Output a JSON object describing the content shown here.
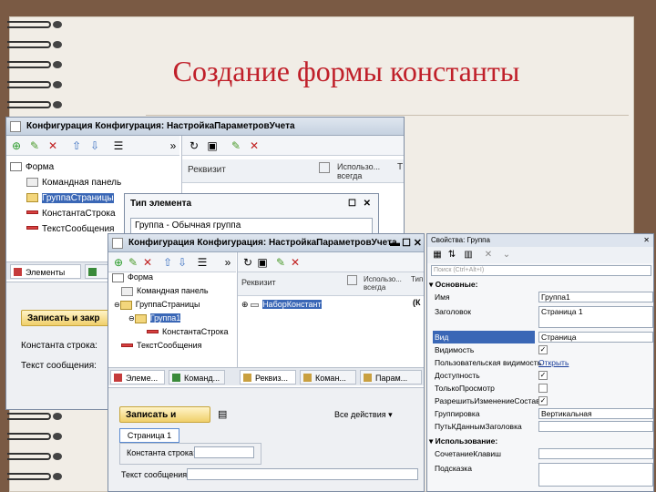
{
  "slide": {
    "title": "Создание формы константы"
  },
  "win1": {
    "title": "Конфигурация Конфигурация: НастройкаПараметровУчета",
    "tree": [
      "Форма",
      "Командная панель",
      "ГруппаСтраницы",
      "КонстантаСтрока",
      "ТекстСообщения"
    ],
    "col_rekvizit": "Реквизит",
    "col_isp": "Использо... всегда",
    "col_t": "Т",
    "tab_elements": "Элементы",
    "btn_save": "Записать и закр",
    "lbl_const": "Константа строка:",
    "lbl_text": "Текст сообщения:"
  },
  "popup": {
    "title": "Тип элемента",
    "value": "Группа - Обычная группа"
  },
  "win2": {
    "title": "Конфигурация Конфигурация: НастройкаПараметровУчета",
    "tree": [
      "Форма",
      "Командная панель",
      "ГруппаСтраницы",
      "Группа1",
      "КонстантаСтрока",
      "ТекстСообщения"
    ],
    "col_rekvizit": "Реквизит",
    "col_isp": "Использо... всегда",
    "col_t": "Тип",
    "attr_row": "НаборКонстант",
    "attr_type": "(К",
    "tabs": [
      "Элеме...",
      "Команд...",
      "Реквиз...",
      "Коман...",
      "Парам..."
    ],
    "btn_save": "Записать и закрыть",
    "all_actions": "Все действия ▾",
    "page_tab": "Страница 1",
    "lbl_const": "Константа строка:",
    "lbl_text": "Текст сообщения:"
  },
  "props": {
    "title": "Свойства: Группа",
    "search_placeholder": "Поиск (Ctrl+Alt+I)",
    "sec_main": "Основные:",
    "sec_use": "Использование:",
    "rows": [
      {
        "k": "Имя",
        "v": "Группа1"
      },
      {
        "k": "Заголовок",
        "v": "Страница 1"
      },
      {
        "k": "Вид",
        "v": "Страница"
      },
      {
        "k": "Видимость",
        "v": "✓"
      },
      {
        "k": "Пользовательская видимость",
        "v": "Открыть"
      },
      {
        "k": "Доступность",
        "v": "✓"
      },
      {
        "k": "ТолькоПросмотр",
        "v": ""
      },
      {
        "k": "РазрешитьИзменениеСостава",
        "v": "✓"
      },
      {
        "k": "Группировка",
        "v": "Вертикальная"
      },
      {
        "k": "ПутьКДаннымЗаголовка",
        "v": ""
      },
      {
        "k": "СочетаниеКлавиш",
        "v": ""
      },
      {
        "k": "Подсказка",
        "v": ""
      }
    ]
  },
  "colors": {
    "title": "#c0202a",
    "selection": "#3a67b6",
    "button": "#f0cf6a"
  }
}
